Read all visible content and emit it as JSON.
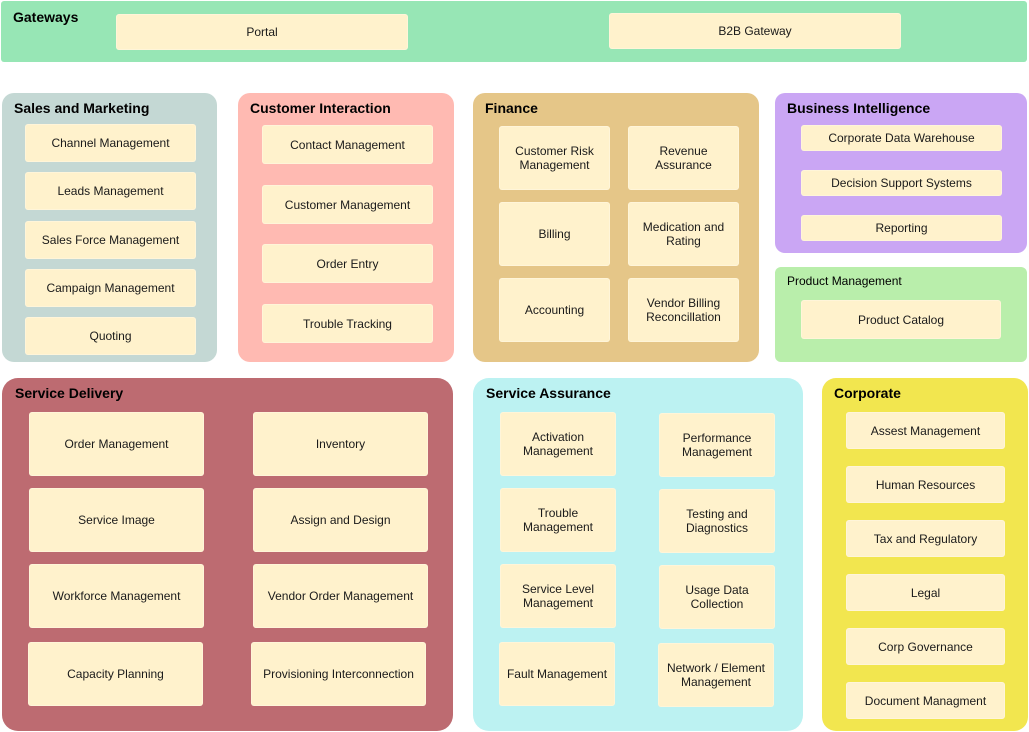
{
  "colors": {
    "box_fill": "#fff2cc",
    "gateways": "#97e6b5",
    "sales_marketing": "#c4d8d4",
    "customer_interaction": "#ffbab2",
    "finance": "#e5c688",
    "business_intelligence": "#caa6f4",
    "product_management": "#b9eeab",
    "service_delivery": "#bd6b71",
    "service_assurance": "#bcf2f2",
    "corporate": "#f2e64f"
  },
  "gateways": {
    "title": "Gateways",
    "items": [
      "Portal",
      "B2B Gateway"
    ]
  },
  "sales_marketing": {
    "title": "Sales and Marketing",
    "items": [
      "Channel Management",
      "Leads Management",
      "Sales Force Management",
      "Campaign Management",
      "Quoting"
    ]
  },
  "customer_interaction": {
    "title": "Customer Interaction",
    "items": [
      "Contact Management",
      "Customer Management",
      "Order Entry",
      "Trouble Tracking"
    ]
  },
  "finance": {
    "title": "Finance",
    "items": [
      "Customer Risk Management",
      "Revenue Assurance",
      "Billing",
      "Medication and Rating",
      "Accounting",
      "Vendor Billing Reconcillation"
    ]
  },
  "business_intelligence": {
    "title": "Business Intelligence",
    "items": [
      "Corporate Data Warehouse",
      "Decision Support Systems",
      "Reporting"
    ]
  },
  "product_management": {
    "title": "Product Management",
    "items": [
      "Product Catalog"
    ]
  },
  "service_delivery": {
    "title": "Service Delivery",
    "items": [
      "Order Management",
      "Inventory",
      "Service Image",
      "Assign and Design",
      "Workforce Management",
      "Vendor Order Management",
      "Capacity Planning",
      "Provisioning Interconnection"
    ]
  },
  "service_assurance": {
    "title": "Service Assurance",
    "items": [
      "Activation Management",
      "Performance Management",
      "Trouble Management",
      "Testing and Diagnostics",
      "Service Level Management",
      "Usage Data Collection",
      "Fault Management",
      "Network / Element Management"
    ]
  },
  "corporate": {
    "title": "Corporate",
    "items": [
      "Assest Management",
      "Human Resources",
      "Tax and Regulatory",
      "Legal",
      "Corp Governance",
      "Document Managment"
    ]
  }
}
